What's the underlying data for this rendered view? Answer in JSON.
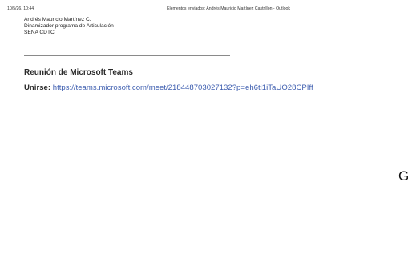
{
  "print_header": {
    "datetime": "10/5/26, 10:44",
    "title": "Elementos enviados: Andrés Mauricio Martínez Castrillón - Outlook"
  },
  "signature": {
    "name": "Andrés Mauricio Martínez C.",
    "role": "Dinamizador programa de Articulación",
    "org": "SENA CDTCI"
  },
  "meeting": {
    "title": "Reunión de Microsoft Teams",
    "join_label": "Unirse:",
    "join_url": "https://teams.microsoft.com/meet/218448703027132?p=eh6ti1iTaUO28CPIff"
  },
  "stray_glyph": "G",
  "colors": {
    "link": "#3f5fb0",
    "text": "#2b2b2b",
    "separator": "#8a8a8a"
  }
}
